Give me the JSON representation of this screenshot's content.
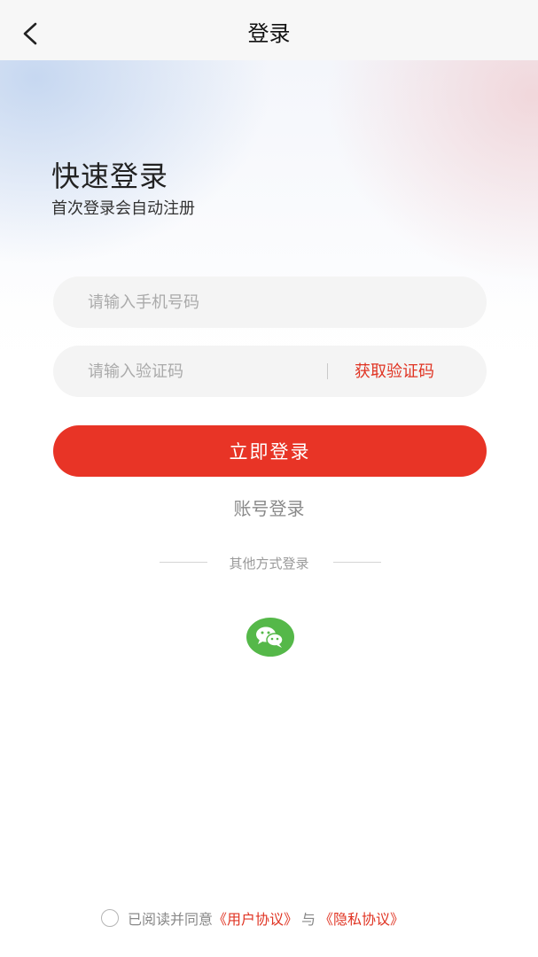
{
  "header": {
    "title": "登录",
    "back_icon": "chevron-left-icon"
  },
  "hero": {
    "title": "快速登录",
    "subtitle": "首次登录会自动注册"
  },
  "form": {
    "phone_placeholder": "请输入手机号码",
    "phone_value": "",
    "code_placeholder": "请输入验证码",
    "code_value": "",
    "get_code_label": "获取验证码",
    "submit_label": "立即登录",
    "account_login_label": "账号登录"
  },
  "other_login": {
    "label": "其他方式登录",
    "wechat_icon": "wechat-icon"
  },
  "agreement": {
    "checked": false,
    "prefix": "已阅读并同意",
    "user_agreement": "《用户协议》",
    "conjunction": "与",
    "privacy_policy": "《隐私协议》"
  },
  "colors": {
    "accent": "#e83426",
    "link": "#e03423",
    "wechat": "#55b849"
  }
}
